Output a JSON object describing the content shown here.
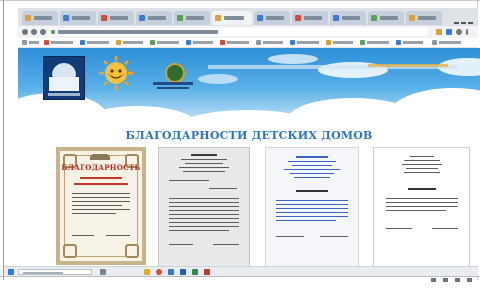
{
  "page": {
    "title": "БЛАГОДАРНОСТИ ДЕТСКИХ ДОМОВ"
  },
  "documents": [
    {
      "name": "certificate",
      "heading": "БЛАГОДАРНОСТЬ"
    },
    {
      "name": "letter-2"
    },
    {
      "name": "letter-3"
    },
    {
      "name": "letter-4"
    }
  ],
  "colors": {
    "title": "#2c73bd",
    "sky": "#3a9be0",
    "certificate_heading": "#c0261d",
    "certificate_frame": "#c8b48a"
  },
  "icons": {
    "tabs": [
      "favicon-icon"
    ],
    "toolbar": [
      "back-icon",
      "forward-icon",
      "reload-icon",
      "home-icon",
      "lock-icon",
      "extension-icon",
      "profile-icon",
      "menu-icon"
    ],
    "taskbar": [
      "windows-start-icon",
      "search-icon",
      "chrome-icon",
      "explorer-icon",
      "mail-icon",
      "word-icon"
    ]
  }
}
